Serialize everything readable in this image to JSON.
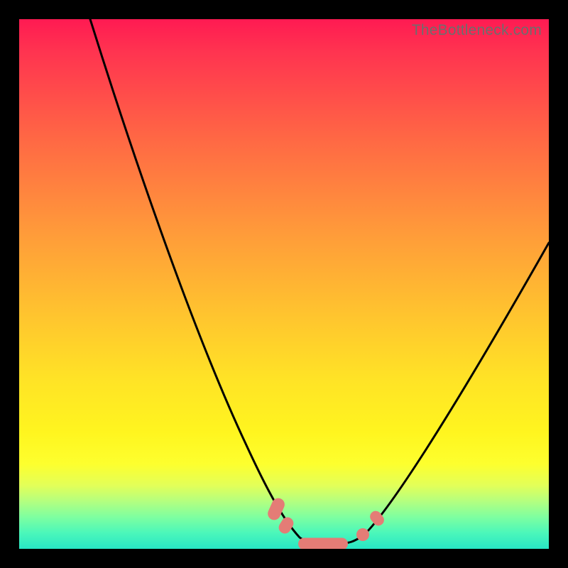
{
  "watermark": "TheBottleneck.com",
  "colors": {
    "frame": "#000000",
    "curve": "#000000",
    "bead": "#e47c76",
    "watermark": "#6d6d6d"
  },
  "chart_data": {
    "type": "line",
    "title": "",
    "xlabel": "",
    "ylabel": "",
    "xlim": [
      0,
      100
    ],
    "ylim": [
      0,
      100
    ],
    "series": [
      {
        "name": "left-branch",
        "x": [
          13.4,
          16,
          20,
          25,
          30,
          35,
          40,
          43,
          46,
          48,
          50,
          52,
          54
        ],
        "y": [
          100,
          92,
          80,
          65,
          50,
          35.5,
          21.5,
          14,
          8,
          5,
          3,
          1.8,
          1.2
        ]
      },
      {
        "name": "valley-floor",
        "x": [
          54,
          56,
          58,
          60,
          62
        ],
        "y": [
          1.2,
          1.0,
          1.0,
          1.0,
          1.2
        ]
      },
      {
        "name": "right-branch",
        "x": [
          62,
          64,
          66,
          68,
          72,
          78,
          85,
          92,
          100
        ],
        "y": [
          1.2,
          2.0,
          3.5,
          5.5,
          11,
          20,
          32,
          44,
          58
        ]
      }
    ],
    "markers": [
      {
        "name": "bead-left-upper",
        "shape": "pill",
        "cx": 48.9,
        "cy": 7.0,
        "angle_deg": 68,
        "len": 4.0
      },
      {
        "name": "bead-left-lower",
        "shape": "pill",
        "cx": 50.3,
        "cy": 4.2,
        "angle_deg": 60,
        "len": 3.0
      },
      {
        "name": "bead-floor",
        "shape": "pill",
        "cx": 57.5,
        "cy": 1.0,
        "angle_deg": 0,
        "len": 8.5
      },
      {
        "name": "bead-right-lower",
        "shape": "dot",
        "cx": 64.8,
        "cy": 2.9,
        "r": 1.4
      },
      {
        "name": "bead-right-upper",
        "shape": "pill",
        "cx": 67.9,
        "cy": 6.0,
        "angle_deg": -55,
        "len": 2.6
      }
    ]
  }
}
